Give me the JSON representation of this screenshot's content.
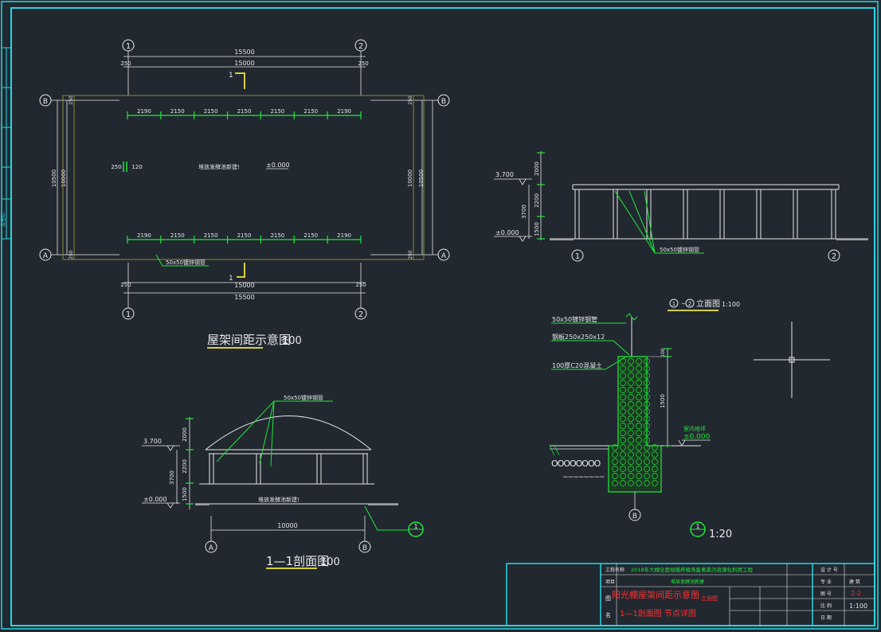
{
  "colors": {
    "background": "#212830",
    "frame": "#25d7e3",
    "green": "#22e83a",
    "white": "#e8e8e8",
    "yellow": "#d6cf3c",
    "red": "#ff3030"
  },
  "plan": {
    "axis_1": "1",
    "axis_2": "2",
    "axis_A": "A",
    "axis_B": "B",
    "dim_total": "15500",
    "dim_inner": "15000",
    "dim_edge": "250",
    "bay_dims": [
      "2190",
      "2150",
      "2150",
      "2150",
      "2150",
      "2150",
      "2190"
    ],
    "height_outer": "10500",
    "height_inner": "10000",
    "dim_250_120": "250",
    "dim_120": "120",
    "center_note": "堆放发酵池新建!",
    "level_label": "±0.000",
    "pipe_label": "50x50镀锌钢管",
    "section_mark": "1",
    "title": "屋架间距示意图",
    "title_scale": "100"
  },
  "elevation": {
    "title_mark1": "1",
    "title_mark2": "2",
    "title_text": "立面图",
    "scale": "1:100",
    "level_top": "3.700",
    "level_base": "±0.000",
    "dim_2000": "2000",
    "dim_2200": "2200",
    "dim_3700": "3700",
    "dim_1500": "1500",
    "pipe_label": "50x50镀锌钢管",
    "axis_1": "1",
    "axis_2": "2"
  },
  "section": {
    "title": "1—1剖面图",
    "scale": "100",
    "level_top": "3.700",
    "level_base": "±0.000",
    "dim_2000": "2000",
    "dim_2200": "2200",
    "dim_3700": "3700",
    "dim_1500": "1500",
    "dim_width": "10000",
    "pipe_label": "50x50镀锌钢管",
    "note": "堆放发酵池新建!",
    "axis_A": "A",
    "axis_B": "B",
    "detail_mark": "1"
  },
  "detail": {
    "label_steel": "50x50镀锌钢管",
    "label_plate": "钢板250x250x12",
    "label_concrete": "100厚C20混凝土",
    "dim_100": "100",
    "dim_1500": "1500",
    "level_note": "室内地坪",
    "level": "±0.000",
    "axis_B": "B",
    "detail_mark": "1",
    "scale": "1:20"
  },
  "title_block": {
    "project_label": "工程名称",
    "project_name": "2018年大棚全面规模养殖场畜禽粪污资源化利用工程",
    "item_label": "项目",
    "item_name": "堆放发酵池新建",
    "drawing_label1": "图",
    "drawing_label2": "名",
    "drawing_name1": "阳光棚屋架间距示意图",
    "drawing_name2": "1—1剖面图  节点详图",
    "drawing_name_overlay": "立面图",
    "design_label": "设 计 号",
    "sheet_label": "图   号",
    "sheet_value": "2-2",
    "scale_label": "比   例",
    "scale_value": "1:100",
    "date_label": "日   期",
    "discipline_label": "专   业",
    "discipline_value": "建 筑"
  },
  "margin_strip": {
    "text": "会签栏"
  }
}
